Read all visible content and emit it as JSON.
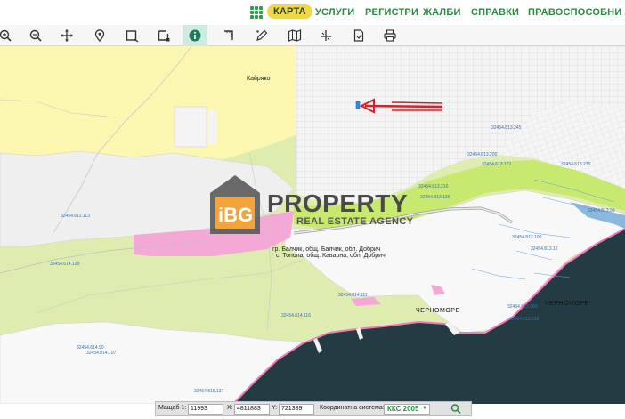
{
  "nav": {
    "items": [
      "КАРТА",
      "УСЛУГИ",
      "РЕГИСТРИ",
      "ЖАЛБИ",
      "СПРАВКИ",
      "ПРАВОСПОСОБНИ ЛИЦА"
    ],
    "active": "КАРТА"
  },
  "toolbar": {
    "tools": [
      "zoom-in-icon",
      "zoom-out-icon",
      "pan-icon",
      "location-pin-icon",
      "select-rectangle-icon",
      "select-area-icon",
      "info-icon",
      "measure-icon",
      "edit-icon",
      "map-layers-icon",
      "cross-section-icon",
      "document-icon",
      "print-icon"
    ],
    "active_tool": "info-icon"
  },
  "map": {
    "place_labels": [
      "Кайряко",
      "гр. Балчик, общ. Балчик, обл. Добрич",
      "с. Топола, общ. Каварна, обл. Добрич"
    ],
    "sea_labels": [
      "ЧЕРНОМОРЕ",
      "ЧЕРНОМОРЕ"
    ],
    "parcel_ids": [
      "32454.612.113",
      "32454.614.120",
      "32454.614.90",
      "32454.814.107",
      "32454.815.137",
      "32454.813.245",
      "32454.813.200",
      "32454.813.216",
      "32454.813.126",
      "32454.613.171",
      "32454.613.270",
      "32454.813.100",
      "32454.813.12",
      "32454.814.111",
      "32454.814.116",
      "32454.813.300",
      "32454.813.310",
      "32454.813.99"
    ],
    "colors": {
      "farmland": "#dfecb0",
      "urban_yellow": "#fbf7b0",
      "built_area": "#f2f2f2",
      "pink_zone": "#f3a8d6",
      "green_strip": "#c7e96f",
      "sea": "#233c44",
      "coast_white": "#fbfbfb",
      "arrow": "#d6202a"
    }
  },
  "watermark": {
    "brand": "iBG",
    "title": "PROPERTY",
    "subtitle": "REAL ESTATE AGENCY"
  },
  "statusbar": {
    "scale_label": "Мащаб 1:",
    "scale_value": "11993",
    "x_label": "X:",
    "x_value": "4811883",
    "y_label": "Y:",
    "y_value": "721389",
    "crs_label": "Координатна система:",
    "crs_value": "ККС 2005"
  }
}
